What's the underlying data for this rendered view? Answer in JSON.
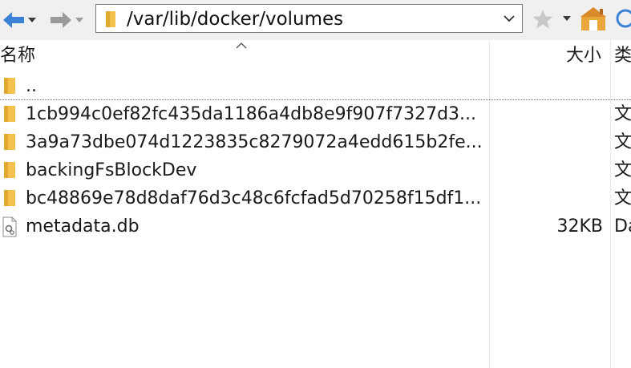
{
  "toolbar": {
    "back_icon": "back-arrow-icon",
    "forward_icon": "forward-arrow-icon",
    "address_path": "/var/lib/docker/volumes",
    "bookmark_icon": "star-icon",
    "home_icon": "home-icon",
    "refresh_icon": "refresh-icon",
    "accent_color": "#3b82d6",
    "folder_color": "#f2c14e"
  },
  "columns": {
    "name": "名称",
    "size": "大小",
    "type": "类"
  },
  "files": [
    {
      "name": "..",
      "size": "",
      "type": "",
      "icon": "folder-icon"
    },
    {
      "name": "1cb994c0ef82fc435da1186a4db8e9f907f7327d3...",
      "size": "",
      "type": "文",
      "icon": "folder-icon"
    },
    {
      "name": "3a9a73dbe074d1223835c8279072a4edd615b2fe...",
      "size": "",
      "type": "文",
      "icon": "folder-icon"
    },
    {
      "name": "backingFsBlockDev",
      "size": "",
      "type": "文",
      "icon": "folder-icon"
    },
    {
      "name": "bc48869e78d8daf76d3c48c6fcfad5d70258f15df1...",
      "size": "",
      "type": "文",
      "icon": "folder-icon"
    },
    {
      "name": "metadata.db",
      "size": "32KB",
      "type": "Da",
      "icon": "file-icon"
    }
  ]
}
